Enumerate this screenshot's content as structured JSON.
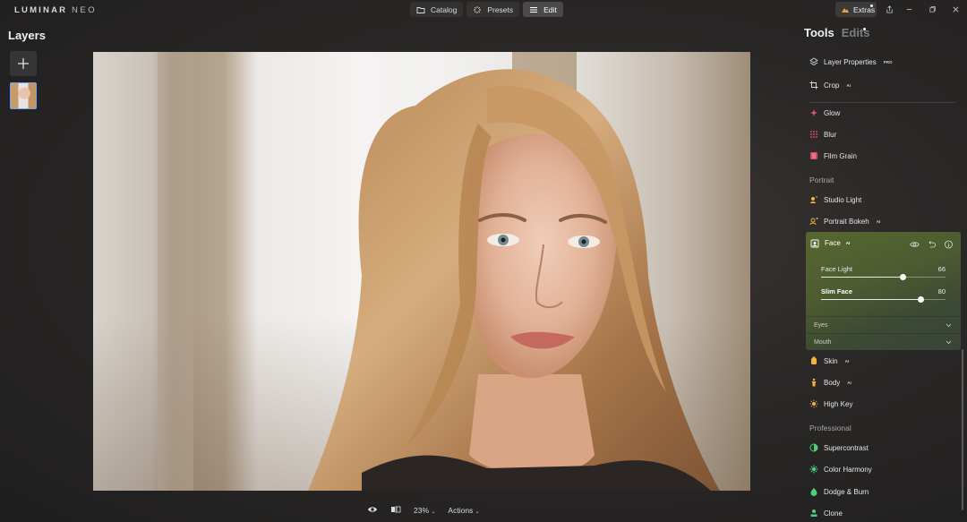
{
  "app": {
    "logo_main": "LUMINAR",
    "logo_neo": "NEO"
  },
  "modes": [
    {
      "label": "Catalog",
      "icon": "folder-icon",
      "active": false
    },
    {
      "label": "Presets",
      "icon": "sparkle-icon",
      "active": false
    },
    {
      "label": "Edit",
      "icon": "sliders-icon",
      "active": true
    }
  ],
  "extras": {
    "label": "Extras"
  },
  "left": {
    "title": "Layers"
  },
  "right": {
    "tabs": [
      {
        "label": "Tools",
        "active": true
      },
      {
        "label": "Edits",
        "active": false
      }
    ],
    "tools_top": [
      {
        "label": "Layer Properties",
        "badge": "PRO",
        "icon": "layers-icon"
      },
      {
        "label": "Crop",
        "badge": "AI",
        "icon": "crop-icon"
      },
      {
        "label": "Glow",
        "badge": "",
        "icon": "glow-icon"
      },
      {
        "label": "Blur",
        "badge": "",
        "icon": "blur-icon"
      },
      {
        "label": "Film Grain",
        "badge": "",
        "icon": "film-grain-icon"
      }
    ],
    "section_portrait": "Portrait",
    "tools_portrait": [
      {
        "label": "Studio Light",
        "badge": "",
        "icon": "studio-light-icon"
      },
      {
        "label": "Portrait Bokeh",
        "badge": "AI",
        "icon": "bokeh-icon"
      }
    ],
    "face": {
      "label": "Face",
      "badge": "AI",
      "sliders": [
        {
          "label": "Face Light",
          "value": "66",
          "fraction": 0.66
        },
        {
          "label": "Slim Face",
          "value": "80",
          "fraction": 0.8
        }
      ],
      "subsections": [
        "Eyes",
        "Mouth"
      ]
    },
    "tools_portrait2": [
      {
        "label": "Skin",
        "badge": "AI",
        "icon": "skin-icon"
      },
      {
        "label": "Body",
        "badge": "AI",
        "icon": "body-icon"
      },
      {
        "label": "High Key",
        "badge": "",
        "icon": "high-key-icon"
      }
    ],
    "section_professional": "Professional",
    "tools_professional": [
      {
        "label": "Supercontrast",
        "badge": "",
        "icon": "supercontrast-icon"
      },
      {
        "label": "Color Harmony",
        "badge": "",
        "icon": "color-harmony-icon"
      },
      {
        "label": "Dodge & Burn",
        "badge": "",
        "icon": "dodge-burn-icon"
      },
      {
        "label": "Clone",
        "badge": "",
        "icon": "clone-icon"
      }
    ]
  },
  "bottom": {
    "zoom": "23%",
    "actions": "Actions"
  },
  "colors": {
    "accent_blue": "#6aa5ff",
    "face_panel": "#52622f",
    "background": "#2a2827"
  }
}
